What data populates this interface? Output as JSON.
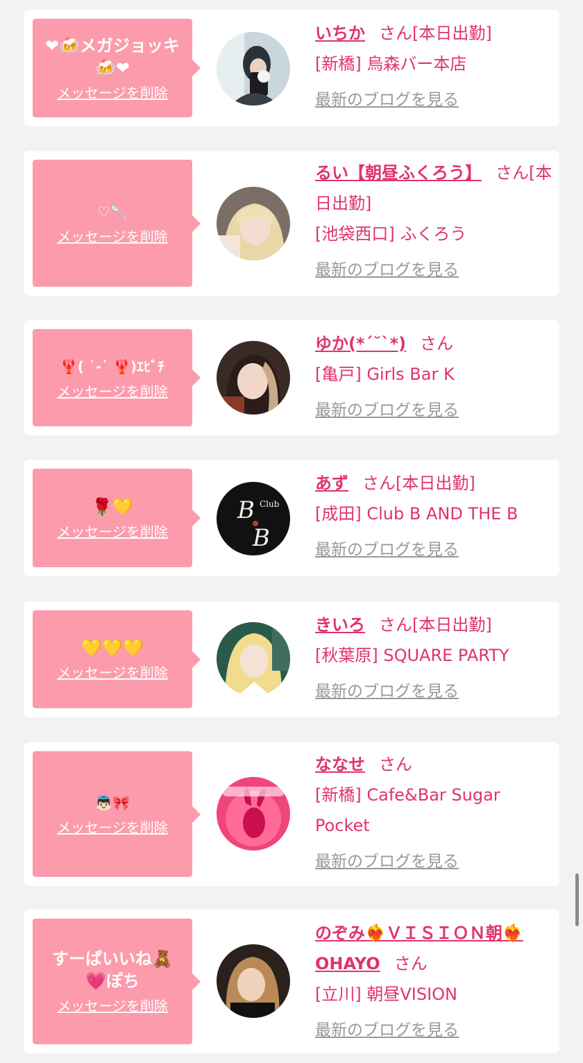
{
  "delete_label": "メッセージを削除",
  "blog_label": "最新のブログを見る",
  "honorific": "さん",
  "colors": {
    "bubble": "#fc9bac",
    "accent": "#e0336a",
    "muted": "#999999",
    "background": "#f2f2f2"
  },
  "entries": [
    {
      "message": "❤🍻メガジョッキ\n🍻❤",
      "name": "いちか",
      "tag": "[本日出勤]",
      "location": "[新橋] 烏森バー本店"
    },
    {
      "message": "♡🥄",
      "name": "るい【朝昼ふくろう】",
      "tag": "[本日出勤]",
      "location": "[池袋西口] ふくろう"
    },
    {
      "message": "🦞( ˙-˙ 🦞)ｴﾋﾞﾁ",
      "name": "ゆか(*´˘`*)",
      "tag": "",
      "location": "[亀戸] Girls Bar K"
    },
    {
      "message": "🌹💛",
      "name": "あず",
      "tag": "[本日出勤]",
      "location": "[成田] Club B AND THE B"
    },
    {
      "message": "💛💛💛",
      "name": "きいろ",
      "tag": "[本日出勤]",
      "location": "[秋葉原] SQUARE PARTY"
    },
    {
      "message": "👼🏻🎀",
      "name": "ななせ",
      "tag": "",
      "location": "[新橋] Cafe&Bar Sugar Pocket"
    },
    {
      "message": "すーぱいいね🧸\n💗ぽち",
      "name": "のぞみ❤️‍🔥ＶＩＳＩＯＮ朝❤️‍🔥OHAYO",
      "tag": "",
      "location": "[立川] 朝昼VISION"
    }
  ]
}
